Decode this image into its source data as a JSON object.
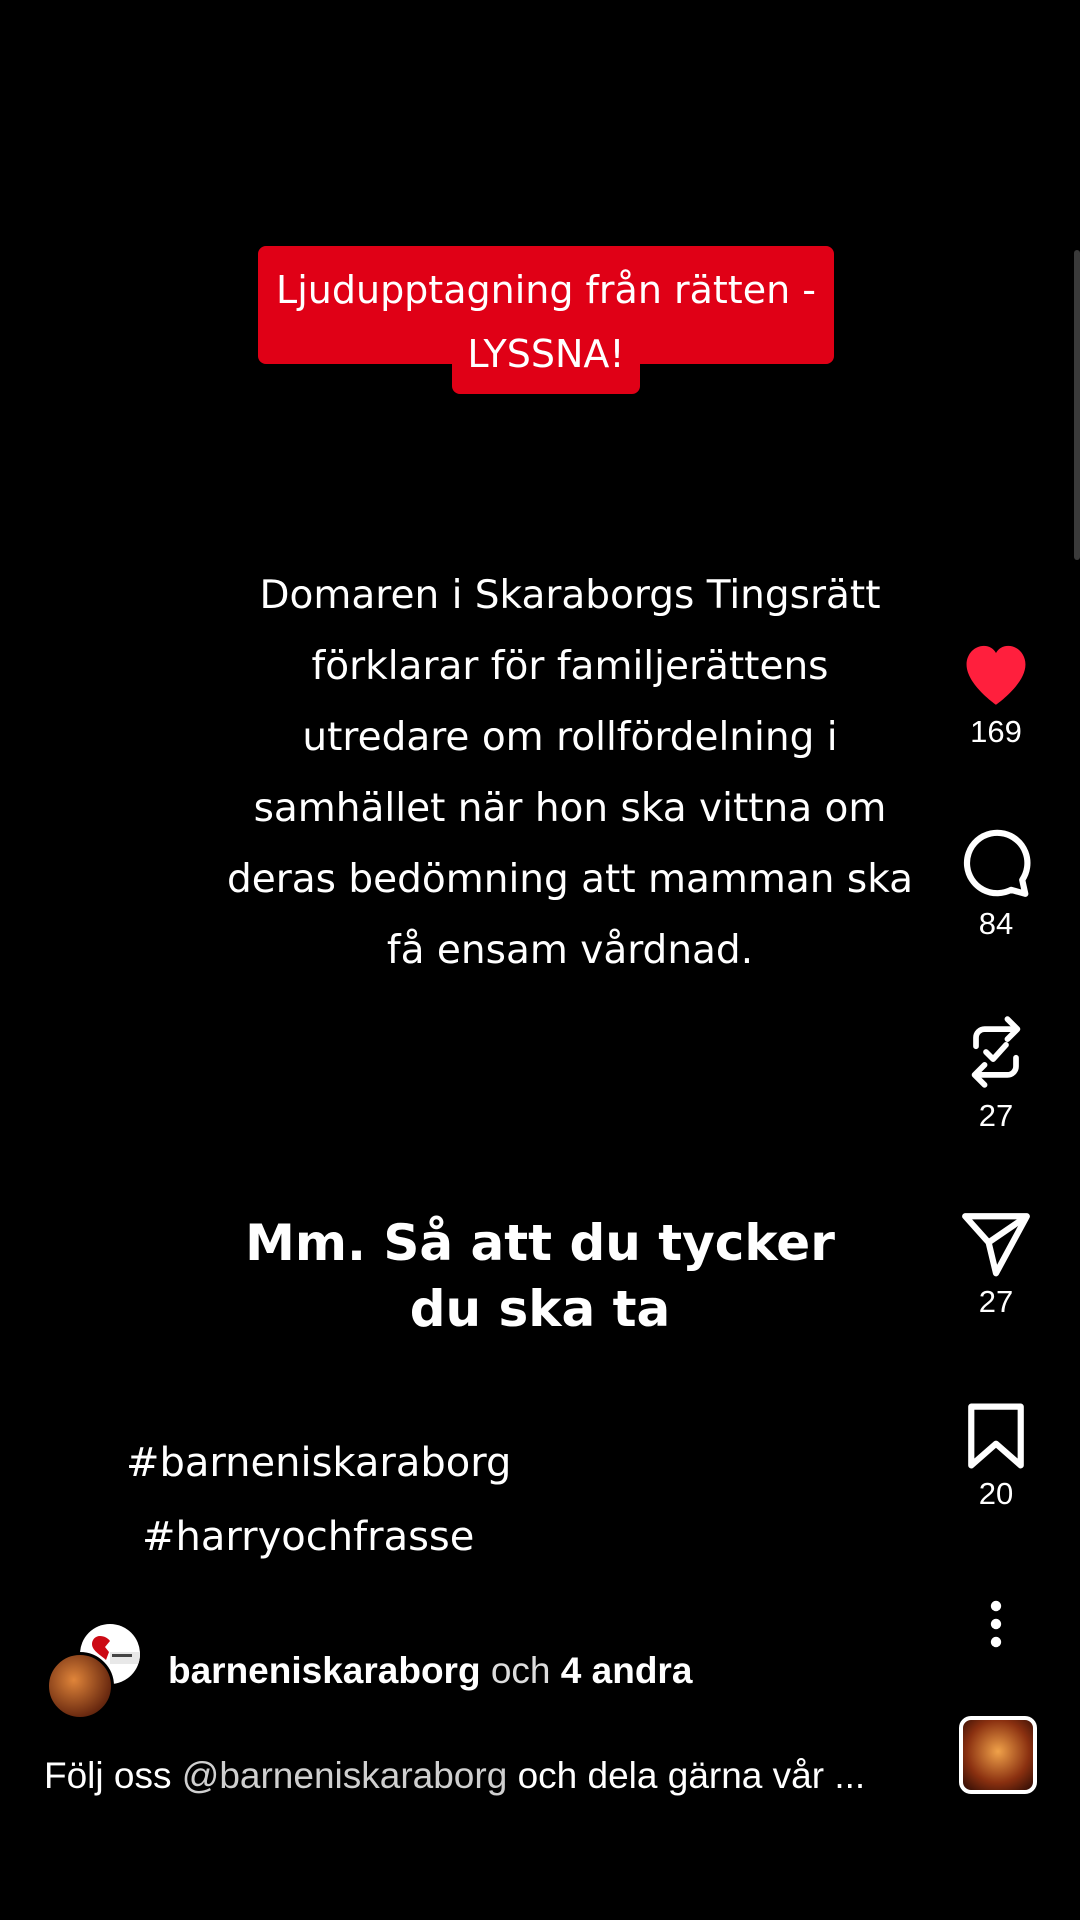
{
  "video": {
    "banner_line1": "Ljudupptagning från rätten -",
    "banner_line2": "LYSSNA!",
    "body_lines": [
      "Domaren i Skaraborgs Tingsrätt",
      "förklarar för familjerättens",
      "utredare om rollfördelning i",
      "samhället när hon ska vittna om",
      "deras bedömning att mamman ska",
      "få ensam vårdnad."
    ],
    "subtitle_line1": "Mm. Så att du tycker",
    "subtitle_line2": "du ska ta",
    "hashtag1": "#barneniskaraborg",
    "hashtag2": "#harryochfrasse"
  },
  "actions": {
    "likes": "169",
    "comments": "84",
    "reposts": "27",
    "shares": "27",
    "saves": "20",
    "like_color": "#ff1f3d"
  },
  "author": {
    "name": "barneniskaraborg",
    "and": "och",
    "others": "4 andra"
  },
  "caption": {
    "prefix": "Följ oss",
    "mention": "@barneniskaraborg",
    "rest": "och dela gärna vår ..."
  }
}
